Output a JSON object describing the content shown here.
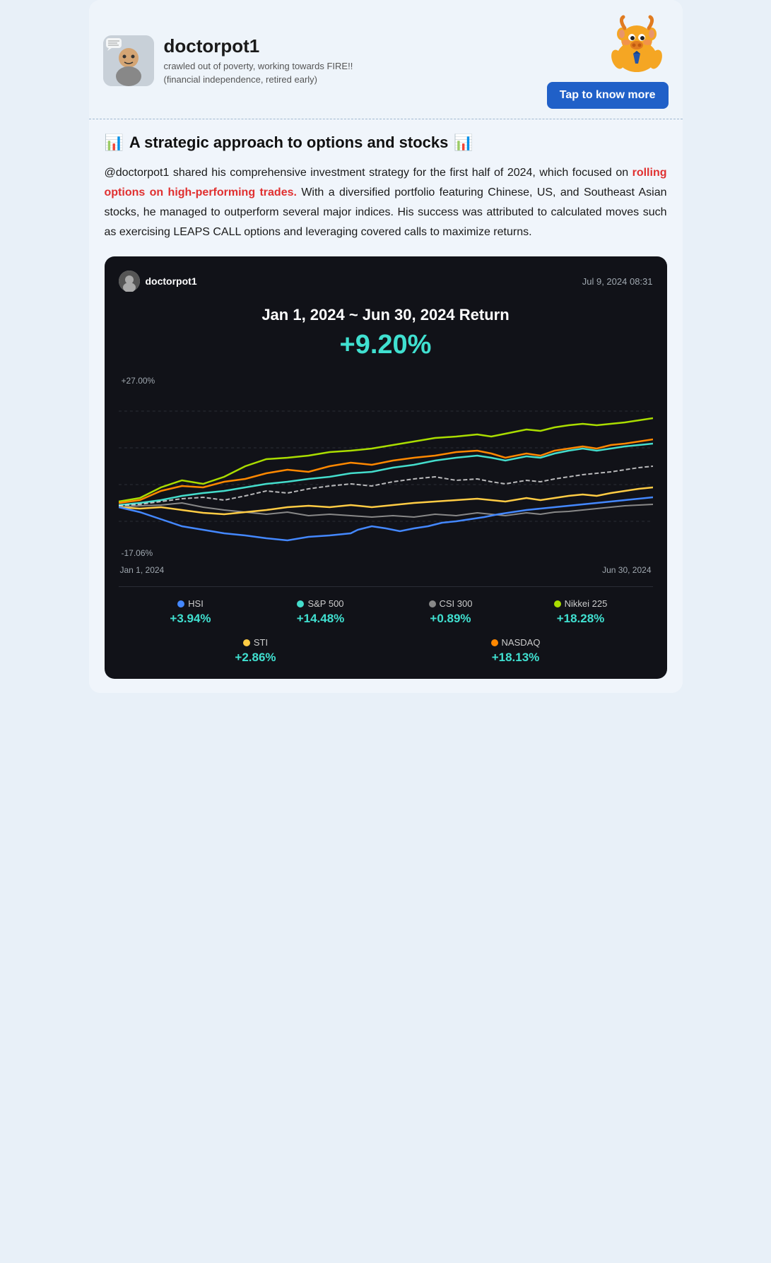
{
  "header": {
    "username": "doctorpot1",
    "bio": "crawled out of poverty, working towards FIRE!! (financial independence, retired early)",
    "tap_button_label": "Tap to know more",
    "bull_emoji": "🐂"
  },
  "article": {
    "title_icon_left": "📊",
    "title_text": "A strategic approach to options and stocks",
    "title_icon_right": "📊",
    "body_normal_1": "@doctorpot1 shared his comprehensive investment strategy for the first half of 2024, which focused on ",
    "body_highlight": "rolling options on high-performing trades.",
    "body_normal_2": " With a diversified portfolio featuring Chinese, US, and Southeast Asian stocks, he managed to outperform several major indices. His success was attributed to calculated moves such as exercising LEAPS CALL options and leveraging covered calls to maximize returns."
  },
  "chart": {
    "username": "doctorpot1",
    "date": "Jul 9, 2024 08:31",
    "title": "Jan 1, 2024 ~ Jun 30, 2024 Return",
    "return_value": "+9.20%",
    "y_label_top": "+27.00%",
    "y_label_bottom": "-17.06%",
    "x_label_left": "Jan 1, 2024",
    "x_label_right": "Jun 30, 2024",
    "legend": [
      {
        "name": "HSI",
        "color": "#4488ff",
        "value": "+3.94%"
      },
      {
        "name": "S&P 500",
        "color": "#44ddcc",
        "value": "+14.48%"
      },
      {
        "name": "CSI 300",
        "color": "#888888",
        "value": "+0.89%"
      },
      {
        "name": "Nikkei 225",
        "color": "#aadd00",
        "value": "+18.28%"
      },
      {
        "name": "STI",
        "color": "#ffcc44",
        "value": "+2.86%"
      },
      {
        "name": "NASDAQ",
        "color": "#ff8800",
        "value": "+18.13%"
      }
    ]
  }
}
